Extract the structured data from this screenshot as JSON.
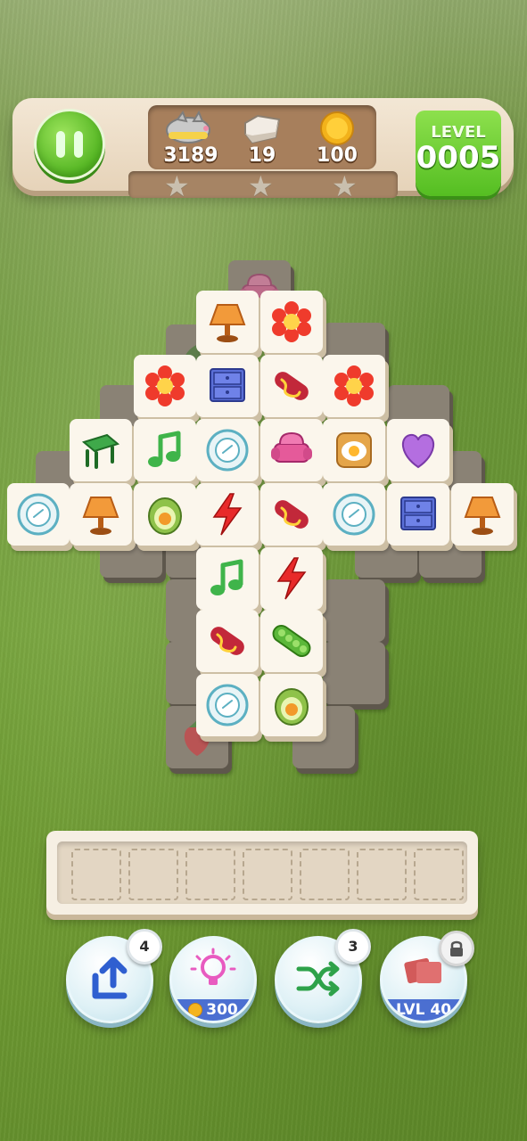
{
  "hud": {
    "fish_count": "3189",
    "stone_count": "19",
    "coin_count": "100",
    "level_label": "LEVEL",
    "level_value": "0005",
    "stars_earned": 0,
    "stars_total": 3
  },
  "tray": {
    "slots": 7
  },
  "powerups": {
    "undo": {
      "badge": "4",
      "icon": "undo-arrow-icon"
    },
    "hint": {
      "cost": "300",
      "icon": "lightbulb-icon"
    },
    "shuffle": {
      "badge": "3",
      "icon": "shuffle-icon"
    },
    "locked": {
      "label": "LVL 40",
      "icon": "cards-icon"
    }
  },
  "tiles": [
    {
      "icon": "armchair",
      "state": "blocked"
    },
    {
      "icon": "lamp",
      "state": "free"
    },
    {
      "icon": "flower",
      "state": "free"
    },
    {
      "icon": "leaf",
      "state": "blocked"
    },
    {
      "icon": "flower",
      "state": "free"
    },
    {
      "icon": "nightstand",
      "state": "free"
    },
    {
      "icon": "hotdog",
      "state": "free"
    },
    {
      "icon": "flower",
      "state": "free"
    },
    {
      "icon": "green-chair",
      "state": "free"
    },
    {
      "icon": "music-note",
      "state": "free"
    },
    {
      "icon": "plate",
      "state": "free"
    },
    {
      "icon": "armchair",
      "state": "free"
    },
    {
      "icon": "toast-egg",
      "state": "free"
    },
    {
      "icon": "heart",
      "state": "free"
    },
    {
      "icon": "plate",
      "state": "free"
    },
    {
      "icon": "lamp",
      "state": "free"
    },
    {
      "icon": "avocado",
      "state": "free"
    },
    {
      "icon": "lightning",
      "state": "free"
    },
    {
      "icon": "hotdog",
      "state": "free"
    },
    {
      "icon": "plate",
      "state": "free"
    },
    {
      "icon": "nightstand",
      "state": "free"
    },
    {
      "icon": "lamp",
      "state": "free"
    },
    {
      "icon": "music-note",
      "state": "free"
    },
    {
      "icon": "lightning",
      "state": "free"
    },
    {
      "icon": "hotdog",
      "state": "free"
    },
    {
      "icon": "peapod",
      "state": "free"
    },
    {
      "icon": "plate",
      "state": "free"
    },
    {
      "icon": "avocado",
      "state": "free"
    },
    {
      "icon": "strawberry",
      "state": "blocked"
    }
  ]
}
